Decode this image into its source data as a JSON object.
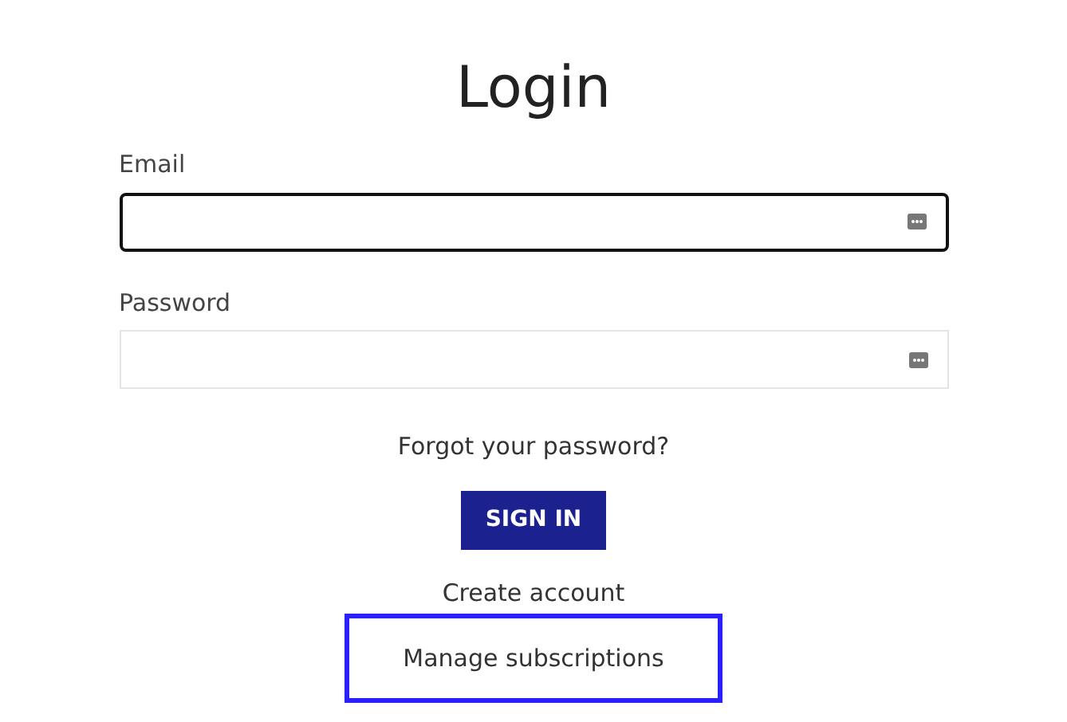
{
  "title": "Login",
  "fields": [
    {
      "label": "Email",
      "focused": true
    },
    {
      "label": "Password",
      "focused": false
    }
  ],
  "forgot_link": "Forgot your password?",
  "submit_button": "SIGN IN",
  "links": [
    {
      "label": "Create account",
      "focused": false
    },
    {
      "label": "Manage subscriptions",
      "focused": true
    }
  ]
}
